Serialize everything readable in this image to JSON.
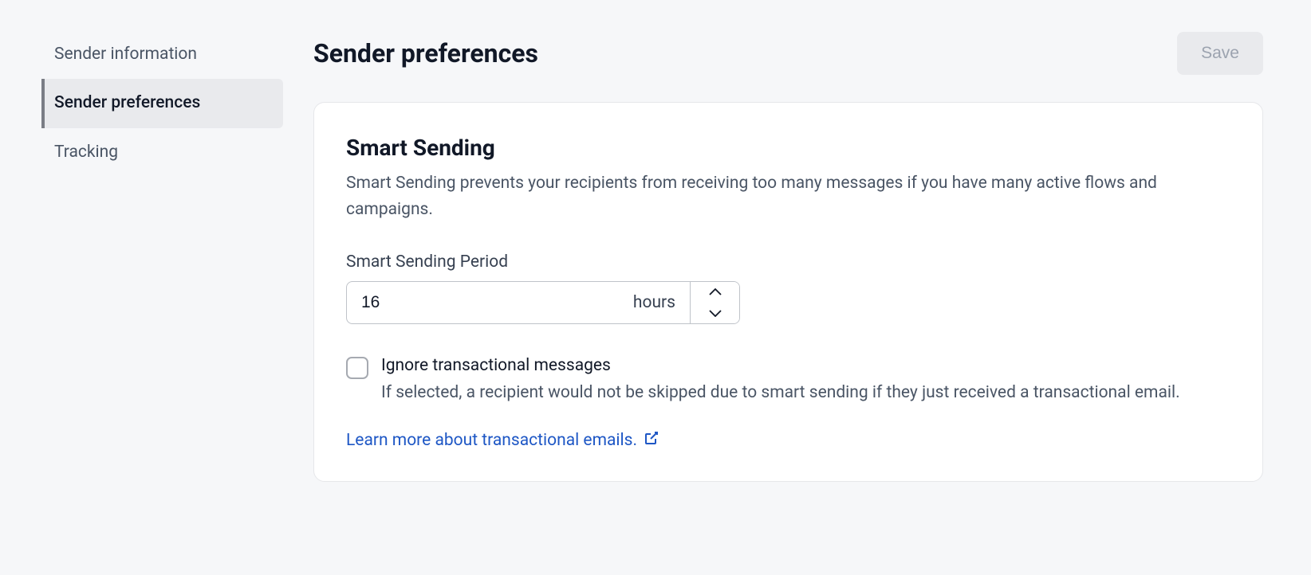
{
  "sidebar": {
    "items": [
      {
        "label": "Sender information"
      },
      {
        "label": "Sender preferences"
      },
      {
        "label": "Tracking"
      }
    ]
  },
  "header": {
    "title": "Sender preferences",
    "save_label": "Save"
  },
  "smart_sending": {
    "title": "Smart Sending",
    "description": "Smart Sending prevents your recipients from receiving too many messages if you have many active flows and campaigns.",
    "period_label": "Smart Sending Period",
    "period_value": "16",
    "period_unit": "hours",
    "ignore_label": "Ignore transactional messages",
    "ignore_desc": "If selected, a recipient would not be skipped due to smart sending if they just received a transactional email.",
    "learn_more": "Learn more about transactional emails."
  }
}
